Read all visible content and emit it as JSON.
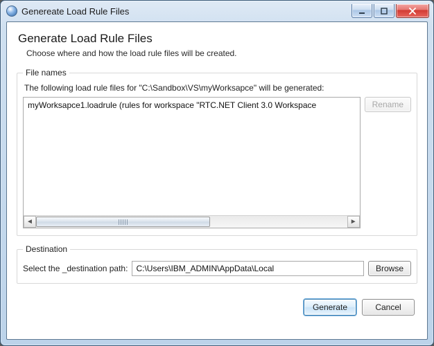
{
  "window": {
    "title": "Genereate Load Rule Files"
  },
  "header": {
    "heading": "Generate Load Rule Files",
    "subheading": "Choose where and how the load rule files will be created."
  },
  "filenames": {
    "legend": "File names",
    "description": "The following load rule files for \"C:\\Sandbox\\VS\\myWorksapce\" will be generated:",
    "items": [
      "myWorksapce1.loadrule  (rules for workspace \"RTC.NET Client 3.0 Workspace"
    ],
    "rename_label": "Rename"
  },
  "destination": {
    "legend": "Destination",
    "label": "Select the _destination path:",
    "value": "C:\\Users\\IBM_ADMIN\\AppData\\Local",
    "browse_label": "Browse"
  },
  "footer": {
    "generate_label": "Generate",
    "cancel_label": "Cancel"
  }
}
